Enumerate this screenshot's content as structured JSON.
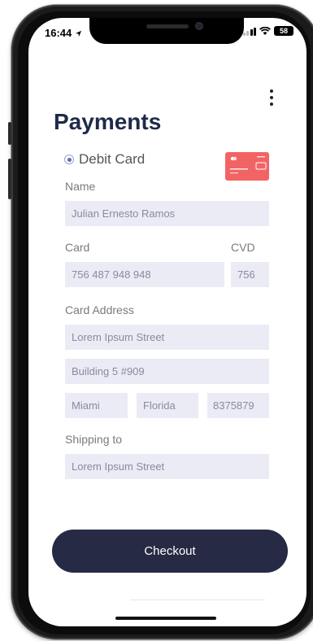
{
  "status_bar": {
    "time": "16:44",
    "battery": "58"
  },
  "page": {
    "title": "Payments"
  },
  "payment_method": {
    "label": "Debit Card",
    "selected": true
  },
  "form": {
    "name_label": "Name",
    "name_value": "Julian Ernesto Ramos",
    "card_label": "Card",
    "card_value": "756 487 948 948",
    "cvd_label": "CVD",
    "cvd_value": "756",
    "address_label": "Card Address",
    "address_line1": "Lorem Ipsum Street",
    "address_line2": "Building 5 #909",
    "city": "Miami",
    "state": "Florida",
    "zip": "8375879",
    "shipping_label": "Shipping to",
    "shipping_value": "Lorem Ipsum Street"
  },
  "checkout_label": "Checkout",
  "colors": {
    "title": "#1f2a4a",
    "field_bg": "#ebebf5",
    "checkout_bg": "#262a44",
    "card_thumb": "#f26464"
  },
  "icons": [
    "location-arrow-icon",
    "signal-icon",
    "wifi-icon",
    "battery-icon",
    "more-vertical-icon",
    "credit-card-icon"
  ]
}
